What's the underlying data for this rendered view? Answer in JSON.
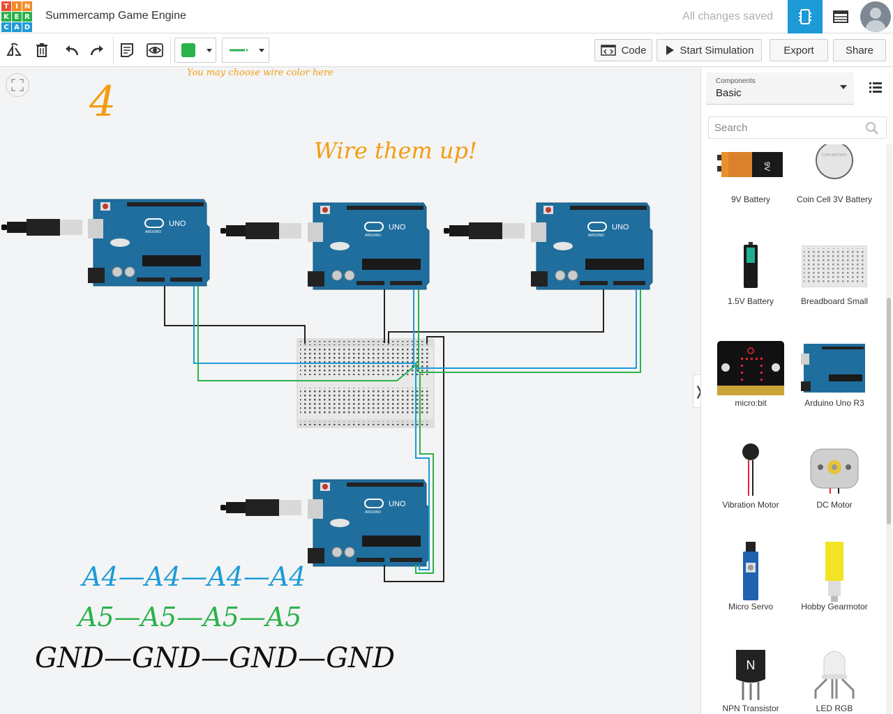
{
  "app": {
    "logo_letters": [
      "T",
      "I",
      "N",
      "K",
      "E",
      "R",
      "C",
      "A",
      "D"
    ],
    "logo_colors": [
      "#e94f37",
      "#f28c28",
      "#f28c28",
      "#2ab24b",
      "#2ab24b",
      "#2ab24b",
      "#1e9ad6",
      "#1e9ad6",
      "#1e9ad6"
    ],
    "title": "Summercamp Game Engine",
    "status": "All changes saved",
    "accent": "#1e9ad6"
  },
  "toolbar": {
    "code_label": "Code",
    "simulate_label": "Start Simulation",
    "export_label": "Export",
    "share_label": "Share",
    "wire_color": "#2ab24b",
    "wire_hint": "You may choose wire color here"
  },
  "canvas": {
    "step_number": "4",
    "instruction": "Wire them up!",
    "legend_a4": "A4—A4—A4—A4",
    "legend_a5": "A5—A5—A5—A5",
    "legend_gnd": "GND—GND—GND—GND",
    "board_logo": "UNO",
    "board_brand": "ARDUINO"
  },
  "panel": {
    "components_label": "Components",
    "components_value": "Basic",
    "search_placeholder": "Search",
    "items": [
      {
        "name": "9V Battery",
        "icon": "battery-9v-icon"
      },
      {
        "name": "Coin Cell 3V Battery",
        "icon": "coin-cell-icon"
      },
      {
        "name": "1.5V Battery",
        "icon": "battery-aa-icon"
      },
      {
        "name": "Breadboard Small",
        "icon": "breadboard-icon"
      },
      {
        "name": "micro:bit",
        "icon": "microbit-icon"
      },
      {
        "name": "Arduino Uno R3",
        "icon": "arduino-icon"
      },
      {
        "name": "Vibration Motor",
        "icon": "vibration-motor-icon"
      },
      {
        "name": "DC Motor",
        "icon": "dc-motor-icon"
      },
      {
        "name": "Micro Servo",
        "icon": "servo-icon"
      },
      {
        "name": "Hobby Gearmotor",
        "icon": "gearmotor-icon"
      },
      {
        "name": "NPN Transistor",
        "icon": "transistor-icon"
      },
      {
        "name": "LED RGB",
        "icon": "led-rgb-icon"
      }
    ],
    "battery_9v_text": "9V",
    "coin_cell_text": "COIN BATTERY",
    "transistor_text": "N"
  }
}
